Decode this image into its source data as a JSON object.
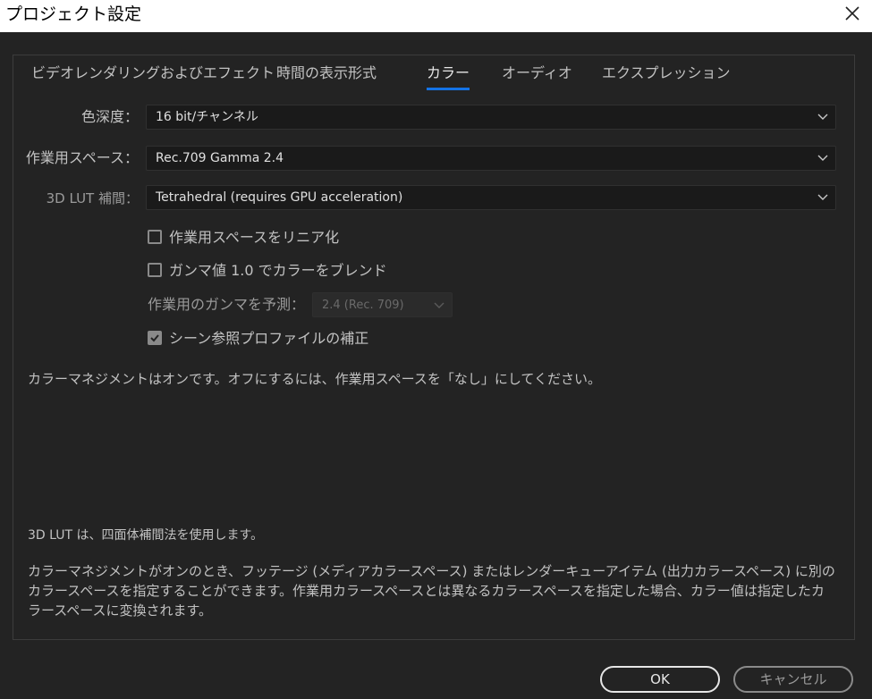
{
  "window": {
    "title": "プロジェクト設定"
  },
  "tabs": [
    {
      "label": "ビデオレンダリングおよびエフェクト",
      "active": false
    },
    {
      "label": "時間の表示形式",
      "active": false
    },
    {
      "label": "カラー",
      "active": true
    },
    {
      "label": "オーディオ",
      "active": false
    },
    {
      "label": "エクスプレッション",
      "active": false
    }
  ],
  "settings": {
    "bit_depth": {
      "label": "色深度：",
      "value": "16 bit/チャンネル"
    },
    "working_space": {
      "label": "作業用スペース：",
      "value": "Rec.709 Gamma 2.4"
    },
    "lut_interp": {
      "label": "3D LUT 補間：",
      "value": "Tetrahedral (requires GPU acceleration)"
    }
  },
  "checkboxes": {
    "linearize": {
      "label": "作業用スペースをリニア化",
      "checked": false
    },
    "blend_gamma": {
      "label": "ガンマ値 1.0 でカラーをブレンド",
      "checked": false
    },
    "scene_referred": {
      "label": "シーン参照プロファイルの補正",
      "checked": true
    }
  },
  "gamma": {
    "label": "作業用のガンマを予測：",
    "value": "2.4 (Rec. 709)"
  },
  "info": {
    "status": "カラーマネジメントはオンです。オフにするには、作業用スペースを「なし」にしてください。",
    "lut_note": "3D LUT は、四面体補間法を使用します。",
    "description": "カラーマネジメントがオンのとき、フッテージ (メディアカラースペース) またはレンダーキューアイテム (出力カラースペース) に別のカラースペースを指定することができます。作業用カラースペースとは異なるカラースペースを指定した場合、カラー値は指定したカラースペースに変換されます。"
  },
  "buttons": {
    "ok": "OK",
    "cancel": "キャンセル"
  },
  "colors": {
    "accent": "#1473e6",
    "background": "#232323",
    "field": "#1a1a1a"
  }
}
